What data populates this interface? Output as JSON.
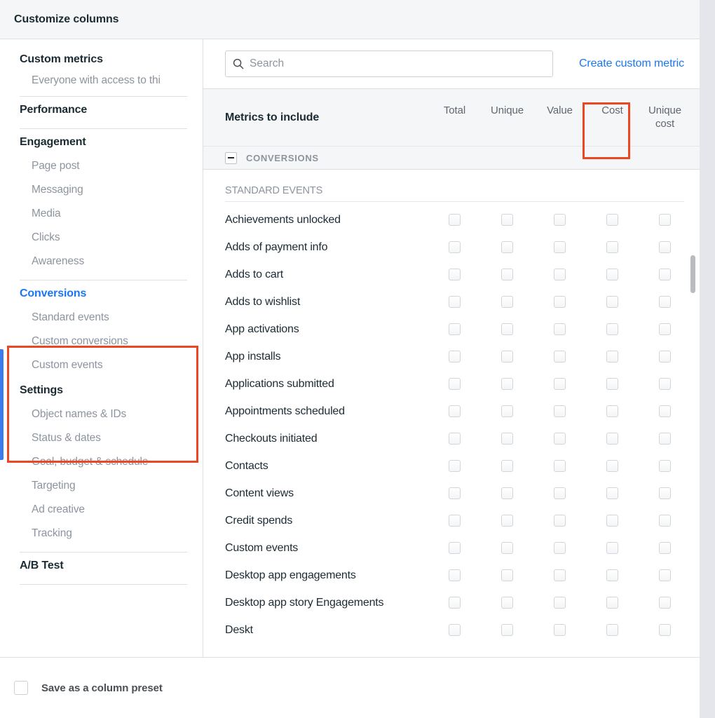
{
  "dialog": {
    "title": "Customize columns"
  },
  "sidebar": {
    "groups": [
      {
        "title": "Custom metrics",
        "active": false,
        "note": "Everyone with access to thi",
        "items": [],
        "divider_after": true
      },
      {
        "title": "Performance",
        "active": false,
        "items": [],
        "divider_after": true
      },
      {
        "title": "Engagement",
        "active": false,
        "items": [
          "Page post",
          "Messaging",
          "Media",
          "Clicks",
          "Awareness"
        ],
        "divider_after": true
      },
      {
        "title": "Conversions",
        "active": true,
        "items": [
          "Standard events",
          "Custom conversions",
          "Custom events"
        ],
        "divider_after": false
      },
      {
        "title": "Settings",
        "active": false,
        "items": [
          "Object names & IDs",
          "Status & dates",
          "Goal, budget & schedule",
          "Targeting",
          "Ad creative",
          "Tracking"
        ],
        "divider_after": true
      },
      {
        "title": "A/B Test",
        "active": false,
        "items": [],
        "divider_after": true
      }
    ]
  },
  "search": {
    "value": "",
    "placeholder": "Search",
    "icon": "search-icon"
  },
  "actions": {
    "create_custom_metric": "Create custom metric"
  },
  "table": {
    "header_title": "Metrics to include",
    "columns": [
      "Total",
      "Unique",
      "Value",
      "Cost",
      "Unique cost"
    ],
    "section": {
      "label": "CONVERSIONS",
      "collapse_icon": "minus-icon",
      "expanded": true
    },
    "subhead": "STANDARD EVENTS",
    "rows": [
      "Achievements unlocked",
      "Adds of payment info",
      "Adds to cart",
      "Adds to wishlist",
      "App activations",
      "App installs",
      "Applications submitted",
      "Appointments scheduled",
      "Checkouts initiated",
      "Contacts",
      "Content views",
      "Credit spends",
      "Custom events",
      "Desktop app engagements",
      "Desktop app story Engagements",
      "Deskt"
    ]
  },
  "footer": {
    "save_preset_label": "Save as a column preset",
    "save_preset_checked": false
  },
  "annotations": [
    {
      "name": "conversions-highlight",
      "color": "#ec4622"
    },
    {
      "name": "cost-column-highlight",
      "color": "#ec4622"
    }
  ],
  "colors": {
    "accent_blue": "#1877f2",
    "annotation_red": "#ec4622",
    "selection_bar": "#3b7ded",
    "header_bg": "#f5f6f7",
    "outer_bg": "#e4e6eb"
  }
}
